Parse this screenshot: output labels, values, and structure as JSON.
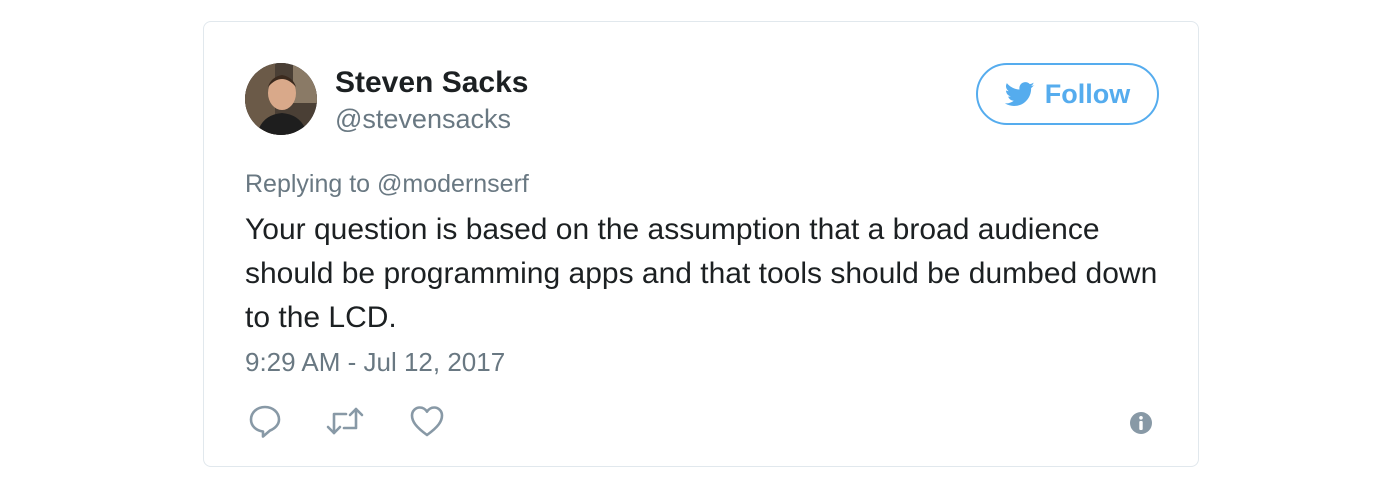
{
  "tweet": {
    "author_name": "Steven Sacks",
    "author_handle": "@stevensacks",
    "follow_label": "Follow",
    "replying_prefix": "Replying to ",
    "replying_to": "@modernserf",
    "text": "Your question is based on the assumption that a broad audience should be programming apps and that tools should be dumbed down to the LCD.",
    "timestamp": "9:29 AM - Jul 12, 2017"
  },
  "icons": {
    "follow": "twitter-bird-icon",
    "reply": "reply-icon",
    "retweet": "retweet-icon",
    "like": "heart-icon",
    "info": "info-icon"
  },
  "colors": {
    "accent": "#55acee",
    "text_primary": "#1c2022",
    "text_secondary": "#697882",
    "border": "#e1e8ed"
  }
}
